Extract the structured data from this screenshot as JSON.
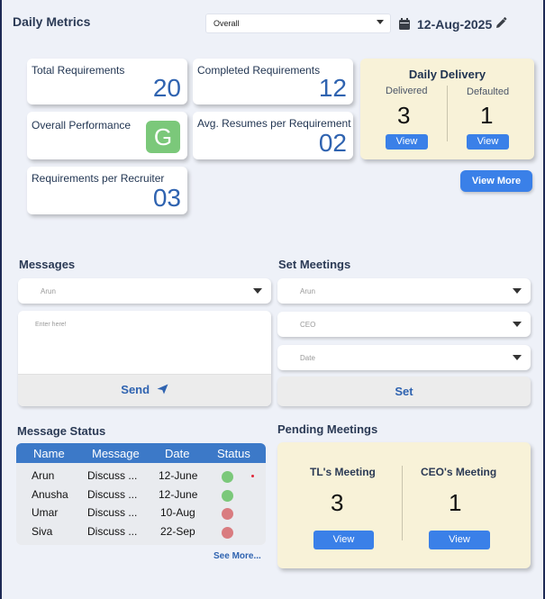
{
  "header": {
    "title": "Daily Metrics",
    "filter_value": "Overall",
    "date": "12-Aug-2025"
  },
  "metrics": {
    "total_requirements": {
      "label": "Total Requirements",
      "value": "20"
    },
    "completed_requirements": {
      "label": "Completed Requirements",
      "value": "12"
    },
    "overall_performance": {
      "label": "Overall  Performance",
      "grade": "G"
    },
    "avg_resumes": {
      "label": "Avg. Resumes per Requirement",
      "value": "02"
    },
    "requirements_per_recruiter": {
      "label": "Requirements per Recruiter",
      "value": "03"
    }
  },
  "daily_delivery": {
    "title": "Daily Delivery",
    "delivered_label": "Delivered",
    "delivered_value": "3",
    "defaulted_label": "Defaulted",
    "defaulted_value": "1",
    "view_label": "View"
  },
  "view_more_label": "View More",
  "messages": {
    "heading": "Messages",
    "recipient": "Arun",
    "placeholder": "Enter here!",
    "send_label": "Send"
  },
  "set_meetings": {
    "heading": "Set Meetings",
    "person": "Arun",
    "role": "CEO",
    "date_placeholder": "Date",
    "set_label": "Set"
  },
  "message_status": {
    "heading": "Message Status",
    "columns": [
      "Name",
      "Message",
      "Date",
      "Status"
    ],
    "rows": [
      {
        "name": "Arun",
        "message": "Discuss ...",
        "date": "12-June",
        "status": "sent"
      },
      {
        "name": "Anusha",
        "message": "Discuss ...",
        "date": "12-June",
        "status": "sent"
      },
      {
        "name": "Umar",
        "message": "Discuss ...",
        "date": "10-Aug",
        "status": "pending"
      },
      {
        "name": "Siva",
        "message": "Discuss ...",
        "date": "22-Sep",
        "status": "pending"
      }
    ],
    "see_more_label": "See More..."
  },
  "pending_meetings": {
    "heading": "Pending Meetings",
    "tl_label": "TL's Meeting",
    "tl_value": "3",
    "ceo_label": "CEO's Meeting",
    "ceo_value": "1",
    "view_label": "View"
  },
  "colors": {
    "accent": "#3a80e8",
    "status_sent": "#7bc87a",
    "status_pending": "#d97c80",
    "card_yellow": "#f8f2d8"
  }
}
